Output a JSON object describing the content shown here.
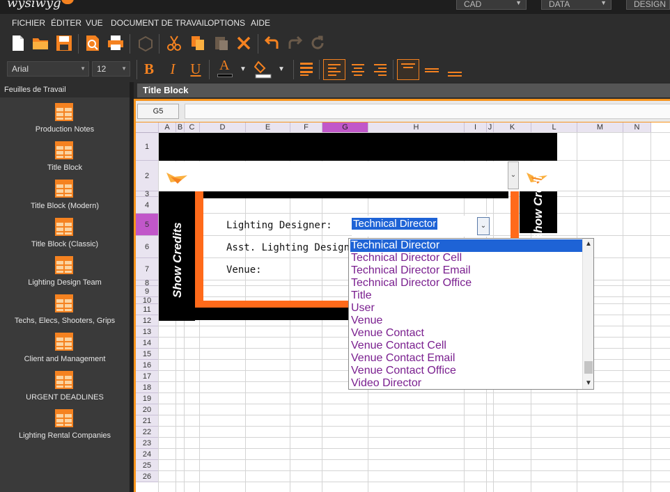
{
  "app": {
    "logo": "wysiwyg"
  },
  "mode_tabs": [
    {
      "label": "CAD"
    },
    {
      "label": "DATA"
    },
    {
      "label": "DESIGN"
    }
  ],
  "menu": [
    "FICHIER",
    "ÉDITER",
    "VUE",
    "DOCUMENT DE TRAVAIL",
    "OPTIONS",
    "AIDE"
  ],
  "toolbar": {
    "font_name": "Arial",
    "font_size": "12",
    "bold": "B",
    "italic": "I",
    "underline": "U",
    "font_color_letter": "A"
  },
  "sidebar": {
    "title": "Feuilles de Travail",
    "items": [
      {
        "label": "Production Notes"
      },
      {
        "label": "Title Block"
      },
      {
        "label": "Title Block (Modern)"
      },
      {
        "label": "Title Block (Classic)"
      },
      {
        "label": "Lighting Design Team"
      },
      {
        "label": "Techs, Elecs, Shooters, Grips"
      },
      {
        "label": "Client and Management"
      },
      {
        "label": "URGENT DEADLINES"
      },
      {
        "label": "Lighting Rental Companies"
      }
    ]
  },
  "document": {
    "title": "Title Block",
    "cell_ref": "G5",
    "columns": [
      "A",
      "B",
      "C",
      "D",
      "E",
      "F",
      "G",
      "H",
      "I",
      "J",
      "K",
      "L",
      "M",
      "N"
    ],
    "rows": [
      "1",
      "2",
      "3",
      "4",
      "5",
      "6",
      "7",
      "8",
      "9",
      "10",
      "11",
      "12",
      "13",
      "14",
      "15",
      "16",
      "17",
      "18",
      "19",
      "20",
      "21",
      "22",
      "23",
      "24",
      "25",
      "26"
    ],
    "selected_column": "G",
    "selected_row": "5",
    "side_text": "Show Credits",
    "labels": {
      "lighting_designer": "Lighting Designer:",
      "asst_lighting_designer": "Asst. Lighting Designer:",
      "venue": "Venue:"
    },
    "cell_value": "Technical Director"
  },
  "dropdown": {
    "selected": "Technical Director",
    "options": [
      "Technical Director",
      "Technical Director Cell",
      "Technical Director Email",
      "Technical Director Office",
      "Title",
      "User",
      "Venue",
      "Venue Contact",
      "Venue Contact Cell",
      "Venue Contact Email",
      "Venue Contact Office",
      "Video Director"
    ]
  },
  "colors": {
    "accent": "#f58220",
    "selection": "#1e63d6",
    "header_selected": "#c157c9",
    "option_text": "#7a1f8f"
  }
}
